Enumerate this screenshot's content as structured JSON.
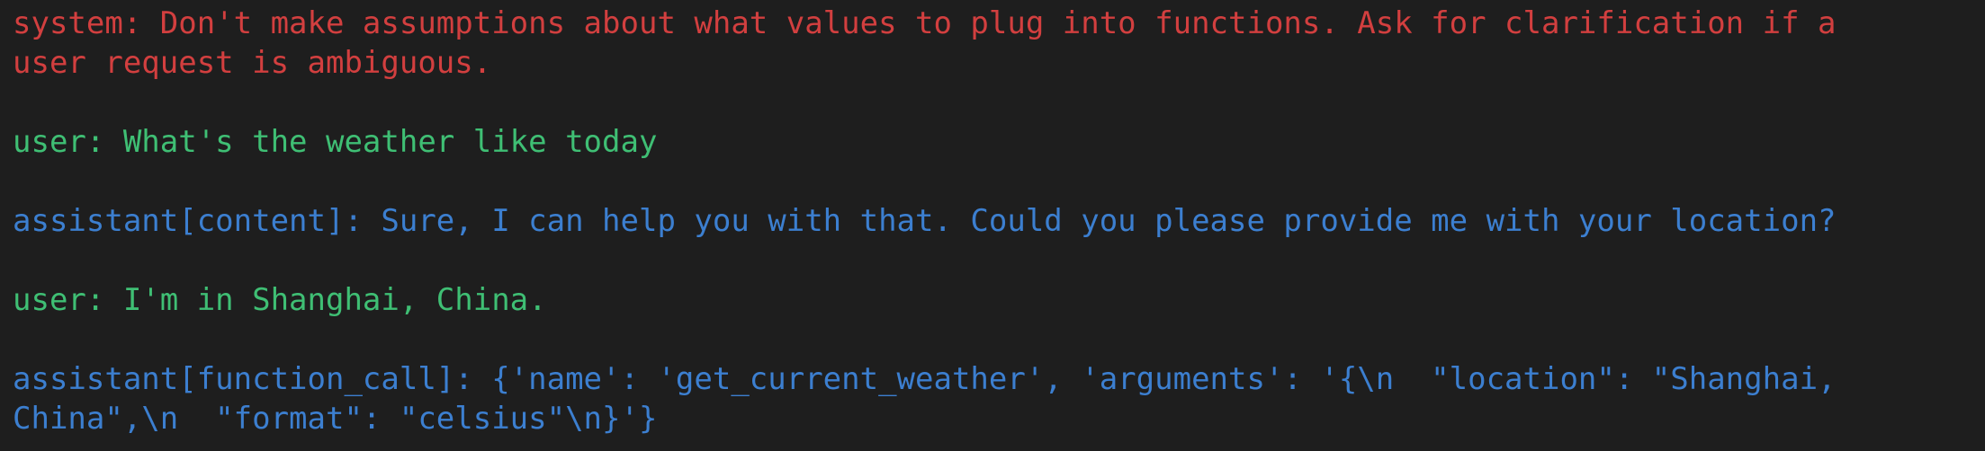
{
  "colors": {
    "background": "#1e1e1e",
    "system": "#d23f3f",
    "user": "#3fbf74",
    "assistant": "#3c7fd0"
  },
  "messages": [
    {
      "role": "system",
      "lines": [
        "system: Don't make assumptions about what values to plug into functions. Ask for clarification if a",
        "user request is ambiguous."
      ]
    },
    {
      "role": "user",
      "lines": [
        "user: What's the weather like today"
      ]
    },
    {
      "role": "assistant",
      "lines": [
        "assistant[content]: Sure, I can help you with that. Could you please provide me with your location?"
      ]
    },
    {
      "role": "user",
      "lines": [
        "user: I'm in Shanghai, China."
      ]
    },
    {
      "role": "assistant",
      "lines": [
        "assistant[function_call]: {'name': 'get_current_weather', 'arguments': '{\\n  \"location\": \"Shanghai,",
        "China\",\\n  \"format\": \"celsius\"\\n}'}"
      ]
    }
  ]
}
